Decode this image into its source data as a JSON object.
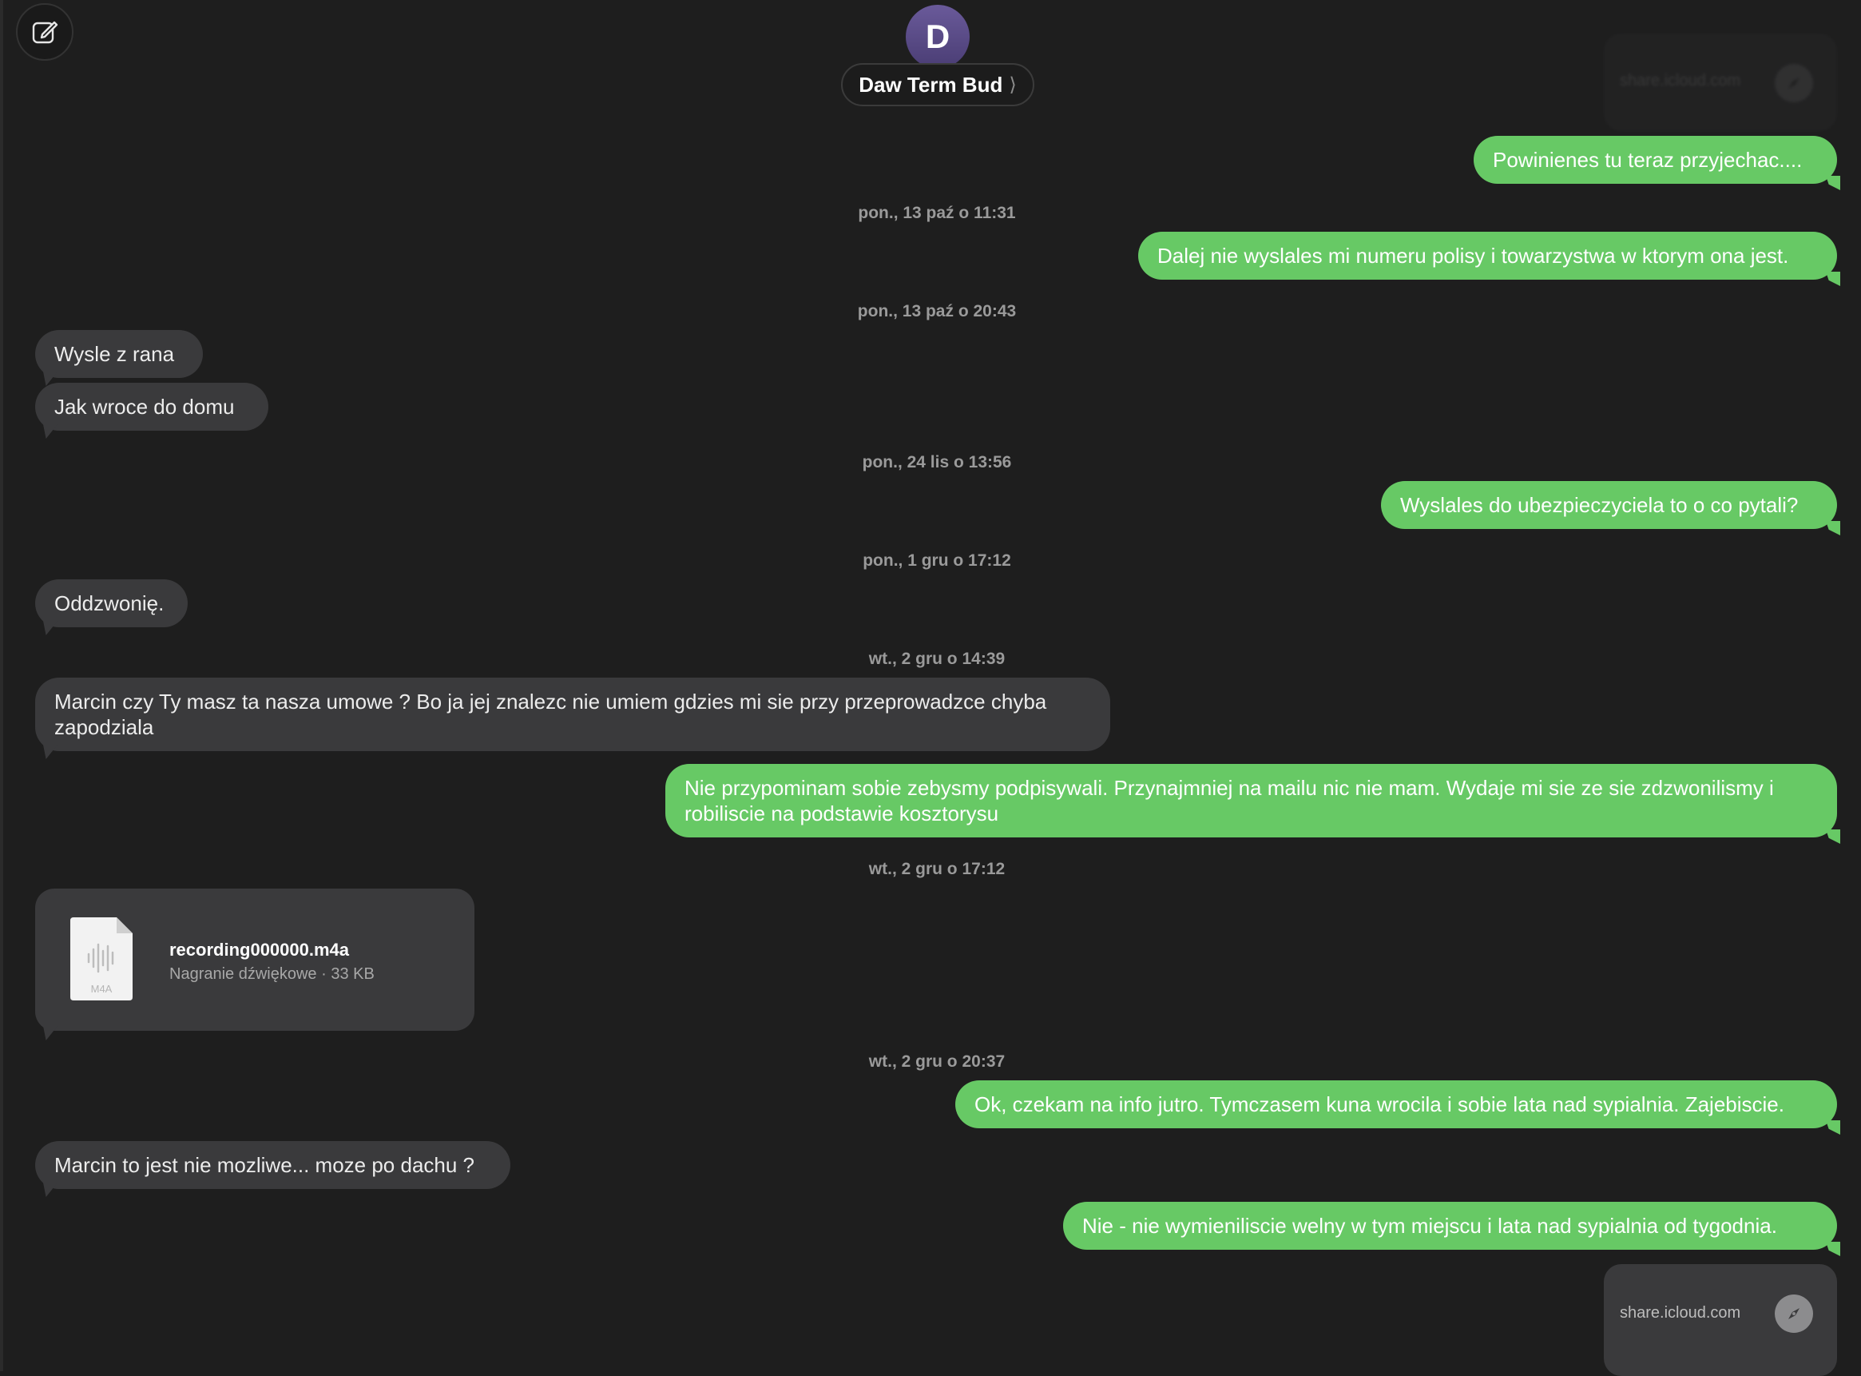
{
  "header": {
    "avatar_initial": "D",
    "contact_name": "Daw Term Bud",
    "contact_chevron": "⟩",
    "compose_icon": "compose-icon"
  },
  "colors": {
    "background": "#1e1e1e",
    "sent_bubble": "#67c965",
    "received_bubble": "#3a3a3c",
    "avatar": "#5a4c88"
  },
  "link_preview_top": {
    "domain": "share.icloud.com",
    "icon": "compass-icon"
  },
  "messages": [
    {
      "text": "Powinienes tu teraz przyjechac...."
    },
    {
      "text": "Dalej nie wyslales mi numeru polisy i towarzystwa w ktorym ona jest."
    },
    {
      "text": "Wysle z rana"
    },
    {
      "text": "Jak wroce do domu"
    },
    {
      "text": "Wyslales do ubezpieczyciela to o co pytali?"
    },
    {
      "text": "Oddzwonię."
    },
    {
      "text": "Marcin czy Ty masz ta nasza umowe ? Bo ja jej znalezc nie umiem gdzies mi sie przy przeprowadzce chyba zapodziala"
    },
    {
      "text": "Nie przypominam sobie zebysmy podpisywali. Przynajmniej na mailu nic nie mam. Wydaje mi sie ze sie zdzwonilismy i robiliscie na podstawie kosztorysu"
    },
    {
      "text": "Ok, czekam na info jutro. Tymczasem kuna wrocila i sobie lata nad sypialnia. Zajebiscie."
    },
    {
      "text": "Marcin to jest nie mozliwe... moze po dachu ?"
    },
    {
      "text": "Nie - nie wymieniliscie welny w tym miejscu i lata nad sypialnia od tygodnia."
    }
  ],
  "timestamps": [
    "pon., 13 paź o 11:31",
    "pon., 13 paź o 20:43",
    "pon., 24 lis o 13:56",
    "pon., 1 gru o 17:12",
    "wt., 2 gru o 14:39",
    "wt., 2 gru o 17:12",
    "wt., 2 gru o 20:37"
  ],
  "attachment": {
    "file_name": "recording000000.m4a",
    "meta": "Nagranie dźwiękowe · 33 KB",
    "file_type_label": "M4A",
    "icon": "audio-file-icon"
  },
  "link_preview_bottom": {
    "domain": "share.icloud.com",
    "icon": "compass-icon"
  }
}
